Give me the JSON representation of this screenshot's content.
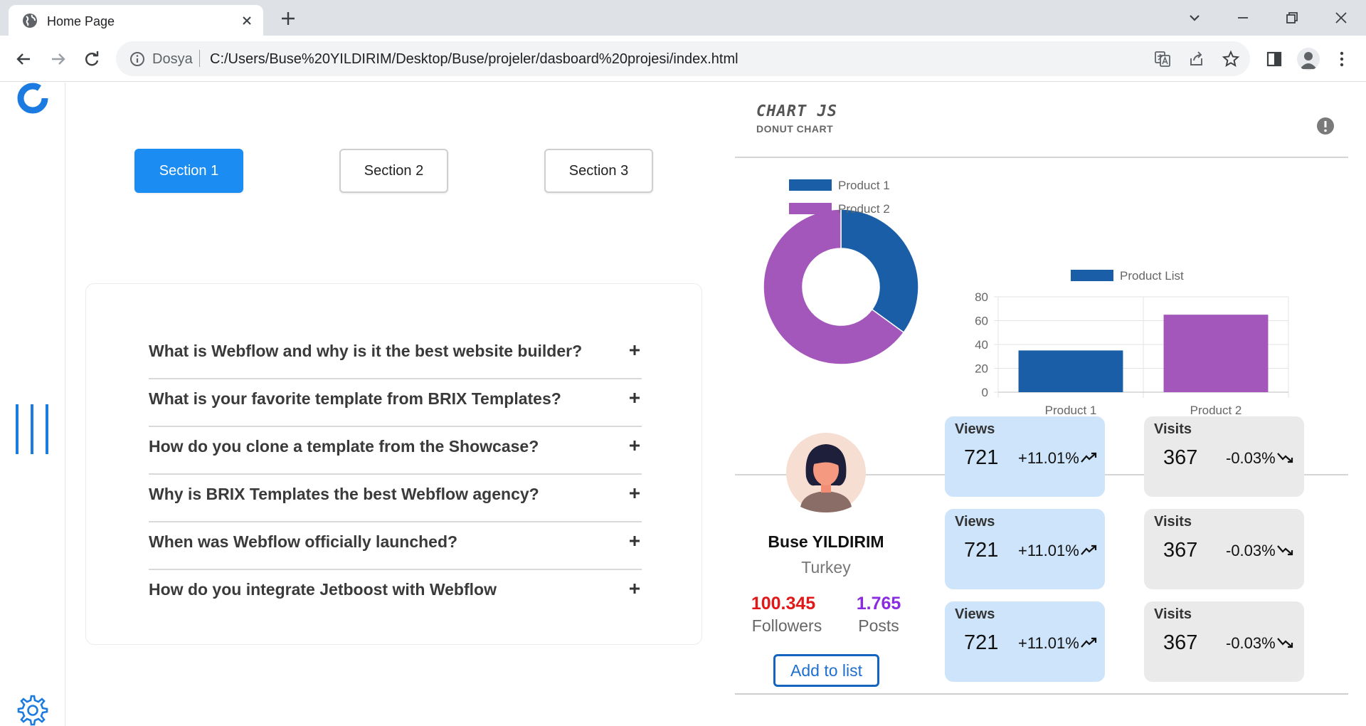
{
  "browser": {
    "tab_title": "Home Page",
    "scheme_label": "Dosya",
    "url": "C:/Users/Buse%20YILDIRIM/Desktop/Buse/projeler/dasboard%20projesi/index.html"
  },
  "sections": [
    "Section 1",
    "Section 2",
    "Section 3"
  ],
  "active_section": "Section 1",
  "faq": [
    "What is Webflow and why is it the best website builder?",
    "What is your favorite template from BRIX Templates?",
    "How do you clone a template from the Showcase?",
    "Why is BRIX Templates the best Webflow agency?",
    "When was Webflow officially launched?",
    "How do you integrate Jetboost with Webflow"
  ],
  "chart_card": {
    "title": "CHART JS",
    "subtitle": "DONUT CHART"
  },
  "chart_data": [
    {
      "type": "pie",
      "donut": true,
      "categories": [
        "Product 1",
        "Product 2"
      ],
      "values": [
        35,
        65
      ],
      "colors": [
        "#1a5ea8",
        "#a457bb"
      ],
      "legend": "top"
    },
    {
      "type": "bar",
      "categories": [
        "Product 1",
        "Product 2"
      ],
      "series": [
        {
          "name": "Product List",
          "values": [
            35,
            65
          ]
        }
      ],
      "colors": [
        "#1a5ea8",
        "#a457bb"
      ],
      "ylim": [
        0,
        80
      ],
      "yticks": [
        0,
        20,
        40,
        60,
        80
      ],
      "grid": true,
      "legend": "top"
    }
  ],
  "profile": {
    "name": "Buse YILDIRIM",
    "country": "Turkey",
    "followers_value": "100.345",
    "followers_label": "Followers",
    "posts_value": "1.765",
    "posts_label": "Posts",
    "add_button": "Add to list"
  },
  "metrics": {
    "views": [
      {
        "label": "Views",
        "value": "721",
        "change": "+11.01%"
      },
      {
        "label": "Views",
        "value": "721",
        "change": "+11.01%"
      },
      {
        "label": "Views",
        "value": "721",
        "change": "+11.01%"
      }
    ],
    "visits": [
      {
        "label": "Visits",
        "value": "367",
        "change": "-0.03%"
      },
      {
        "label": "Visits",
        "value": "367",
        "change": "-0.03%"
      },
      {
        "label": "Visits",
        "value": "367",
        "change": "-0.03%"
      }
    ]
  },
  "colors": {
    "accent": "#1b8cf2",
    "followers": "#e21818",
    "posts": "#8a2be2",
    "views_bg": "#cde4fb",
    "visits_bg": "#eaeaea"
  }
}
